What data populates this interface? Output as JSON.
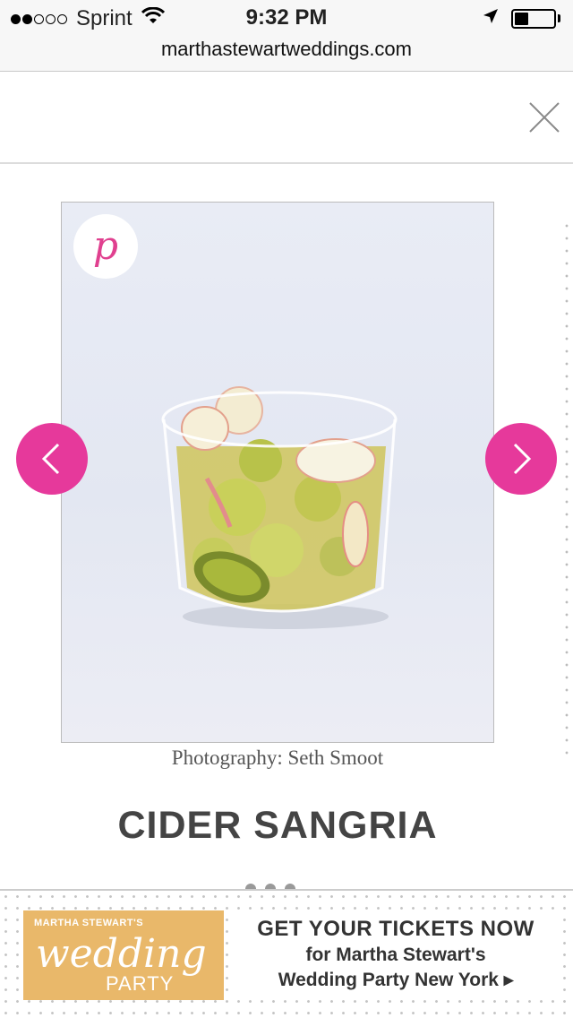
{
  "status_bar": {
    "signal_filled": 2,
    "signal_total": 5,
    "carrier": "Sprint",
    "time": "9:32 PM",
    "battery_level": 0.35,
    "icons": [
      "wifi-icon",
      "location-arrow-icon",
      "battery-icon"
    ]
  },
  "browser": {
    "url": "marthastewartweddings.com"
  },
  "header": {
    "close_icon": "close-icon"
  },
  "gallery": {
    "pin_label": "p",
    "prev_icon": "chevron-left-icon",
    "next_icon": "chevron-right-icon",
    "credit": "Photography: Seth Smoot",
    "title": "CIDER SANGRIA"
  },
  "ad": {
    "logo_brand": "MARTHA STEWART'S",
    "logo_wedding": "wedding",
    "logo_party": "PARTY",
    "headline": "GET YOUR TICKETS NOW",
    "line1": "for Martha Stewart's",
    "line2": "Wedding Party New York ▸"
  },
  "colors": {
    "accent_pink": "#e6399b",
    "ad_gold": "#e9b86a"
  }
}
